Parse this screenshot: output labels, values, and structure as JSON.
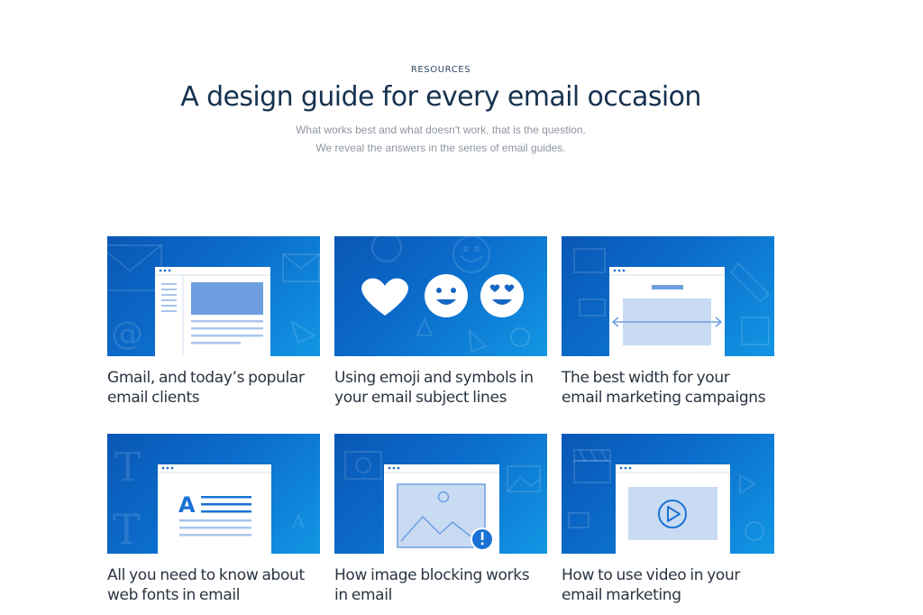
{
  "header": {
    "eyebrow": "RESOURCES",
    "title": "A design guide for every email occasion",
    "subtitle_line1": "What works best and what doesn't work, that is the question.",
    "subtitle_line2": "We reveal the answers in the series of email guides."
  },
  "colors": {
    "thumb_dark": "#0a57b5",
    "thumb_light": "#1296e4",
    "window_fill": "#ffffff",
    "panel_fill": "#c9daf3",
    "title_color": "#16324f",
    "caption_color": "#2a3441"
  },
  "cards": [
    {
      "title_line1": "Gmail, and today’s popular",
      "title_line2": "email clients",
      "icon": "email-client-window-icon"
    },
    {
      "title_line1": "Using emoji and symbols in",
      "title_line2": "your email subject lines",
      "icon": "emoji-heart-smiley-icon"
    },
    {
      "title_line1": "The best width for your",
      "title_line2": "email marketing campaigns",
      "icon": "width-arrows-window-icon"
    },
    {
      "title_line1": "All you need to know about",
      "title_line2": "web fonts in email",
      "icon": "web-font-text-icon"
    },
    {
      "title_line1": "How image blocking works",
      "title_line2": "in email",
      "icon": "blocked-image-icon"
    },
    {
      "title_line1": "How to use video in your",
      "title_line2": "email marketing",
      "icon": "video-play-icon"
    }
  ]
}
